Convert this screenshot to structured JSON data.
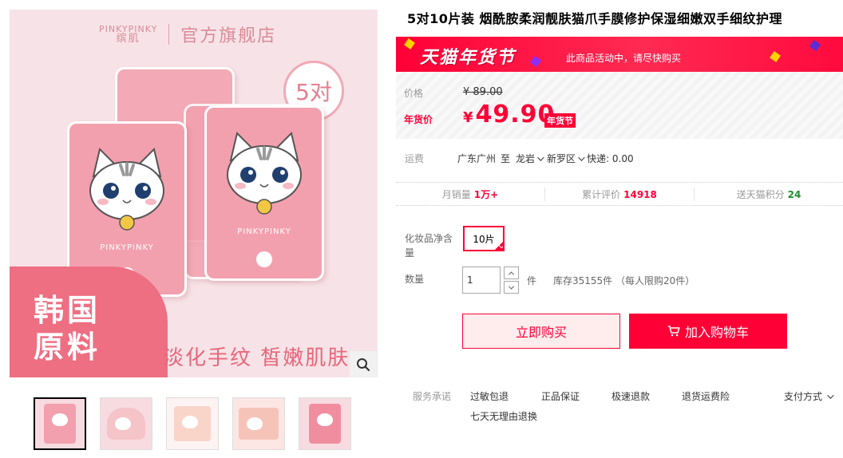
{
  "product": {
    "title": "5对10片装 烟酰胺柔润靓肤猫爪手膜修护保湿细嫩双手细纹护理"
  },
  "main_image": {
    "brand_en": "PINKYPINKY",
    "brand_cn": "缤肌",
    "store": "官方旗舰店",
    "pair_badge": "5对",
    "mask_brand": "PINKYPINKY",
    "blob_line1": "韩国",
    "blob_line2": "原料",
    "tagline": "淡化手纹  皙嫩肌肤"
  },
  "thumbnails": [
    {
      "name": "thumb-1"
    },
    {
      "name": "thumb-2"
    },
    {
      "name": "thumb-3"
    },
    {
      "name": "thumb-4"
    },
    {
      "name": "thumb-5"
    }
  ],
  "promo": {
    "title": "天猫年货节",
    "note": "此商品活动中，请尽快购买"
  },
  "price": {
    "label": "价格",
    "original": "¥ 89.00",
    "festival_label": "年货价",
    "currency": "¥",
    "current": "49.90",
    "festival_tag": "年货节"
  },
  "shipping": {
    "label": "运费",
    "from": "广东广州",
    "to_word": "至",
    "city": "龙岩",
    "district": "新罗区",
    "express": "快递: 0.00"
  },
  "stats": {
    "monthly_sales_label": "月销量",
    "monthly_sales": "1万+",
    "reviews_label": "累计评价",
    "reviews": "14918",
    "points_label": "送天猫积分",
    "points": "24"
  },
  "spec": {
    "label": "化妆品净含量",
    "selected": "10片"
  },
  "quantity": {
    "label": "数量",
    "value": "1",
    "unit": "件",
    "stock": "库存35155件 （每人限购20件）"
  },
  "buttons": {
    "buy_now": "立即购买",
    "add_cart": "加入购物车"
  },
  "service": {
    "label": "服务承诺",
    "items": [
      "过敏包退",
      "正品保证",
      "极速退款",
      "退货运费险",
      "七天无理由退换"
    ],
    "pay_method": "支付方式"
  },
  "colors": {
    "accent": "#ff0036",
    "promo_banner": "#ff0036",
    "image_pink": "#f7e3e7",
    "points_green": "#1b8f2c"
  }
}
